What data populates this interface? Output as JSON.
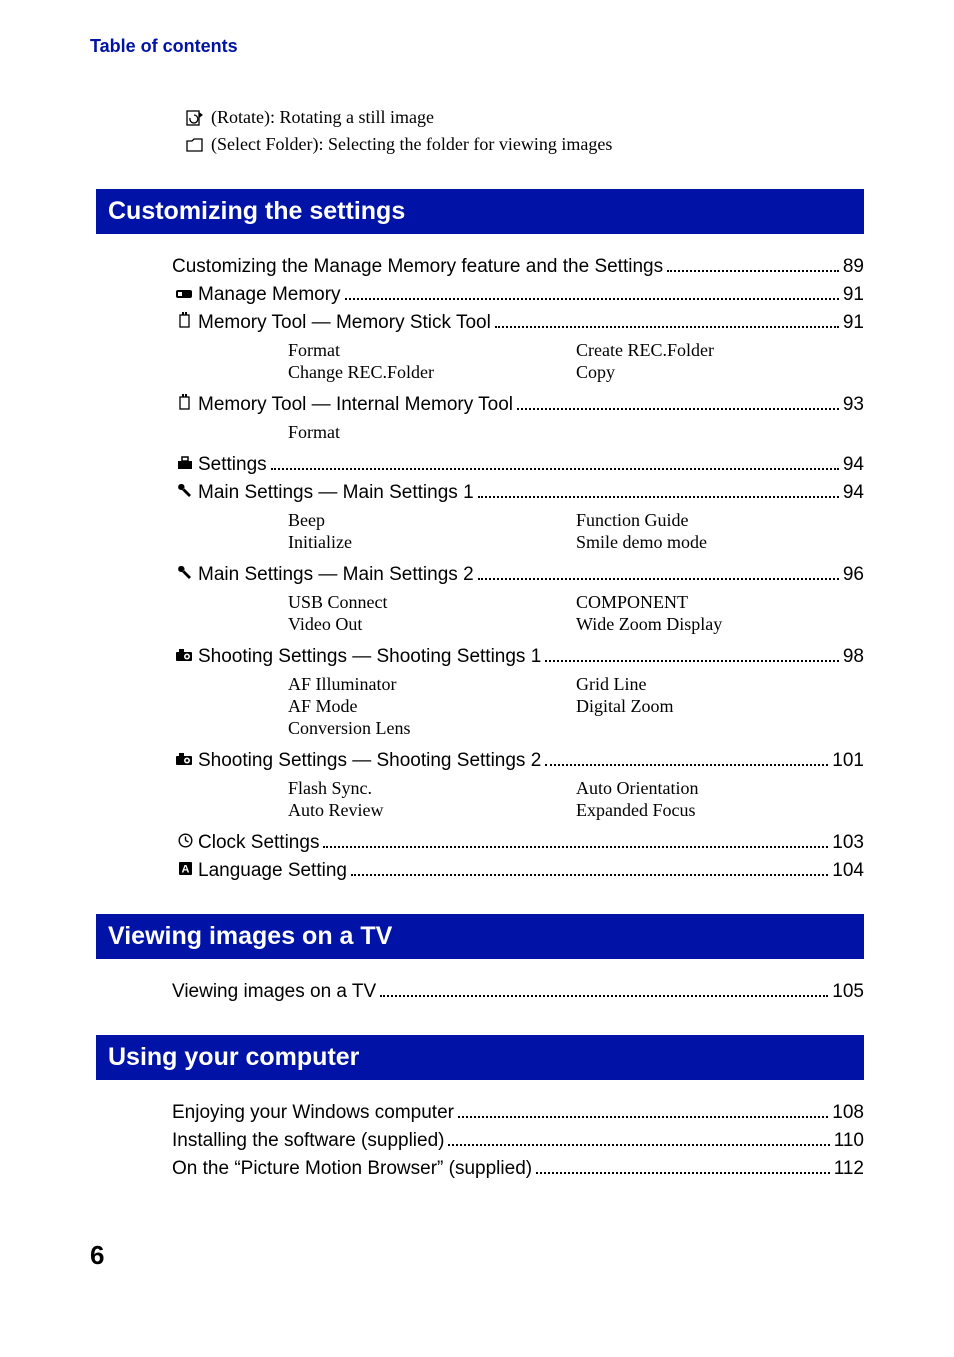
{
  "header": "Table of contents",
  "intro": {
    "rotate": " (Rotate): Rotating a still image",
    "selectFolder": " (Select Folder): Selecting the folder for viewing images"
  },
  "sections": {
    "custom": {
      "title": "Customizing the settings",
      "entries": {
        "e0": {
          "label": "Customizing the Manage Memory feature and the Settings",
          "page": "89"
        },
        "e1": {
          "label": "Manage Memory",
          "page": "91"
        },
        "e2": {
          "label": "Memory Tool — Memory Stick Tool",
          "page": "91"
        },
        "e2sub": {
          "left": [
            "Format",
            "Change REC.Folder"
          ],
          "right": [
            "Create REC.Folder",
            "Copy"
          ]
        },
        "e3": {
          "label": "Memory Tool — Internal Memory Tool",
          "page": "93"
        },
        "e3sub": {
          "left": [
            "Format"
          ],
          "right": []
        },
        "e4": {
          "label": "Settings",
          "page": "94"
        },
        "e5": {
          "label": "Main Settings — Main Settings 1",
          "page": "94"
        },
        "e5sub": {
          "left": [
            "Beep",
            "Initialize"
          ],
          "right": [
            "Function Guide",
            "Smile demo mode"
          ]
        },
        "e6": {
          "label": "Main Settings — Main Settings 2",
          "page": "96"
        },
        "e6sub": {
          "left": [
            "USB Connect",
            "Video Out"
          ],
          "right": [
            "COMPONENT",
            "Wide Zoom Display"
          ]
        },
        "e7": {
          "label": "Shooting Settings — Shooting Settings 1",
          "page": "98"
        },
        "e7sub": {
          "left": [
            "AF Illuminator",
            "AF Mode",
            "Conversion Lens"
          ],
          "right": [
            "Grid Line",
            "Digital Zoom"
          ]
        },
        "e8": {
          "label": "Shooting Settings — Shooting Settings 2",
          "page": "101"
        },
        "e8sub": {
          "left": [
            "Flash Sync.",
            "Auto Review"
          ],
          "right": [
            "Auto Orientation",
            "Expanded Focus"
          ]
        },
        "e9": {
          "label": "Clock Settings",
          "page": "103"
        },
        "e10": {
          "label": "Language Setting",
          "page": "104"
        }
      }
    },
    "tv": {
      "title": "Viewing images on a TV",
      "entries": {
        "e0": {
          "label": "Viewing images on a TV",
          "page": "105"
        }
      }
    },
    "computer": {
      "title": "Using your computer",
      "entries": {
        "e0": {
          "label": "Enjoying your Windows computer",
          "page": "108"
        },
        "e1": {
          "label": "Installing the software (supplied)",
          "page": "110"
        },
        "e2": {
          "label": "On the “Picture Motion Browser” (supplied)",
          "page": "112"
        }
      }
    }
  },
  "pageNumber": "6"
}
